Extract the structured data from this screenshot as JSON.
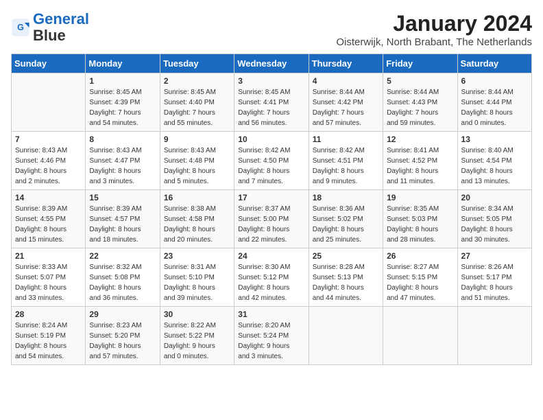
{
  "header": {
    "logo_line1": "General",
    "logo_line2": "Blue",
    "title": "January 2024",
    "subtitle": "Oisterwijk, North Brabant, The Netherlands"
  },
  "weekdays": [
    "Sunday",
    "Monday",
    "Tuesday",
    "Wednesday",
    "Thursday",
    "Friday",
    "Saturday"
  ],
  "weeks": [
    [
      {
        "num": "",
        "info": ""
      },
      {
        "num": "1",
        "info": "Sunrise: 8:45 AM\nSunset: 4:39 PM\nDaylight: 7 hours\nand 54 minutes."
      },
      {
        "num": "2",
        "info": "Sunrise: 8:45 AM\nSunset: 4:40 PM\nDaylight: 7 hours\nand 55 minutes."
      },
      {
        "num": "3",
        "info": "Sunrise: 8:45 AM\nSunset: 4:41 PM\nDaylight: 7 hours\nand 56 minutes."
      },
      {
        "num": "4",
        "info": "Sunrise: 8:44 AM\nSunset: 4:42 PM\nDaylight: 7 hours\nand 57 minutes."
      },
      {
        "num": "5",
        "info": "Sunrise: 8:44 AM\nSunset: 4:43 PM\nDaylight: 7 hours\nand 59 minutes."
      },
      {
        "num": "6",
        "info": "Sunrise: 8:44 AM\nSunset: 4:44 PM\nDaylight: 8 hours\nand 0 minutes."
      }
    ],
    [
      {
        "num": "7",
        "info": "Sunrise: 8:43 AM\nSunset: 4:46 PM\nDaylight: 8 hours\nand 2 minutes."
      },
      {
        "num": "8",
        "info": "Sunrise: 8:43 AM\nSunset: 4:47 PM\nDaylight: 8 hours\nand 3 minutes."
      },
      {
        "num": "9",
        "info": "Sunrise: 8:43 AM\nSunset: 4:48 PM\nDaylight: 8 hours\nand 5 minutes."
      },
      {
        "num": "10",
        "info": "Sunrise: 8:42 AM\nSunset: 4:50 PM\nDaylight: 8 hours\nand 7 minutes."
      },
      {
        "num": "11",
        "info": "Sunrise: 8:42 AM\nSunset: 4:51 PM\nDaylight: 8 hours\nand 9 minutes."
      },
      {
        "num": "12",
        "info": "Sunrise: 8:41 AM\nSunset: 4:52 PM\nDaylight: 8 hours\nand 11 minutes."
      },
      {
        "num": "13",
        "info": "Sunrise: 8:40 AM\nSunset: 4:54 PM\nDaylight: 8 hours\nand 13 minutes."
      }
    ],
    [
      {
        "num": "14",
        "info": "Sunrise: 8:39 AM\nSunset: 4:55 PM\nDaylight: 8 hours\nand 15 minutes."
      },
      {
        "num": "15",
        "info": "Sunrise: 8:39 AM\nSunset: 4:57 PM\nDaylight: 8 hours\nand 18 minutes."
      },
      {
        "num": "16",
        "info": "Sunrise: 8:38 AM\nSunset: 4:58 PM\nDaylight: 8 hours\nand 20 minutes."
      },
      {
        "num": "17",
        "info": "Sunrise: 8:37 AM\nSunset: 5:00 PM\nDaylight: 8 hours\nand 22 minutes."
      },
      {
        "num": "18",
        "info": "Sunrise: 8:36 AM\nSunset: 5:02 PM\nDaylight: 8 hours\nand 25 minutes."
      },
      {
        "num": "19",
        "info": "Sunrise: 8:35 AM\nSunset: 5:03 PM\nDaylight: 8 hours\nand 28 minutes."
      },
      {
        "num": "20",
        "info": "Sunrise: 8:34 AM\nSunset: 5:05 PM\nDaylight: 8 hours\nand 30 minutes."
      }
    ],
    [
      {
        "num": "21",
        "info": "Sunrise: 8:33 AM\nSunset: 5:07 PM\nDaylight: 8 hours\nand 33 minutes."
      },
      {
        "num": "22",
        "info": "Sunrise: 8:32 AM\nSunset: 5:08 PM\nDaylight: 8 hours\nand 36 minutes."
      },
      {
        "num": "23",
        "info": "Sunrise: 8:31 AM\nSunset: 5:10 PM\nDaylight: 8 hours\nand 39 minutes."
      },
      {
        "num": "24",
        "info": "Sunrise: 8:30 AM\nSunset: 5:12 PM\nDaylight: 8 hours\nand 42 minutes."
      },
      {
        "num": "25",
        "info": "Sunrise: 8:28 AM\nSunset: 5:13 PM\nDaylight: 8 hours\nand 44 minutes."
      },
      {
        "num": "26",
        "info": "Sunrise: 8:27 AM\nSunset: 5:15 PM\nDaylight: 8 hours\nand 47 minutes."
      },
      {
        "num": "27",
        "info": "Sunrise: 8:26 AM\nSunset: 5:17 PM\nDaylight: 8 hours\nand 51 minutes."
      }
    ],
    [
      {
        "num": "28",
        "info": "Sunrise: 8:24 AM\nSunset: 5:19 PM\nDaylight: 8 hours\nand 54 minutes."
      },
      {
        "num": "29",
        "info": "Sunrise: 8:23 AM\nSunset: 5:20 PM\nDaylight: 8 hours\nand 57 minutes."
      },
      {
        "num": "30",
        "info": "Sunrise: 8:22 AM\nSunset: 5:22 PM\nDaylight: 9 hours\nand 0 minutes."
      },
      {
        "num": "31",
        "info": "Sunrise: 8:20 AM\nSunset: 5:24 PM\nDaylight: 9 hours\nand 3 minutes."
      },
      {
        "num": "",
        "info": ""
      },
      {
        "num": "",
        "info": ""
      },
      {
        "num": "",
        "info": ""
      }
    ]
  ]
}
